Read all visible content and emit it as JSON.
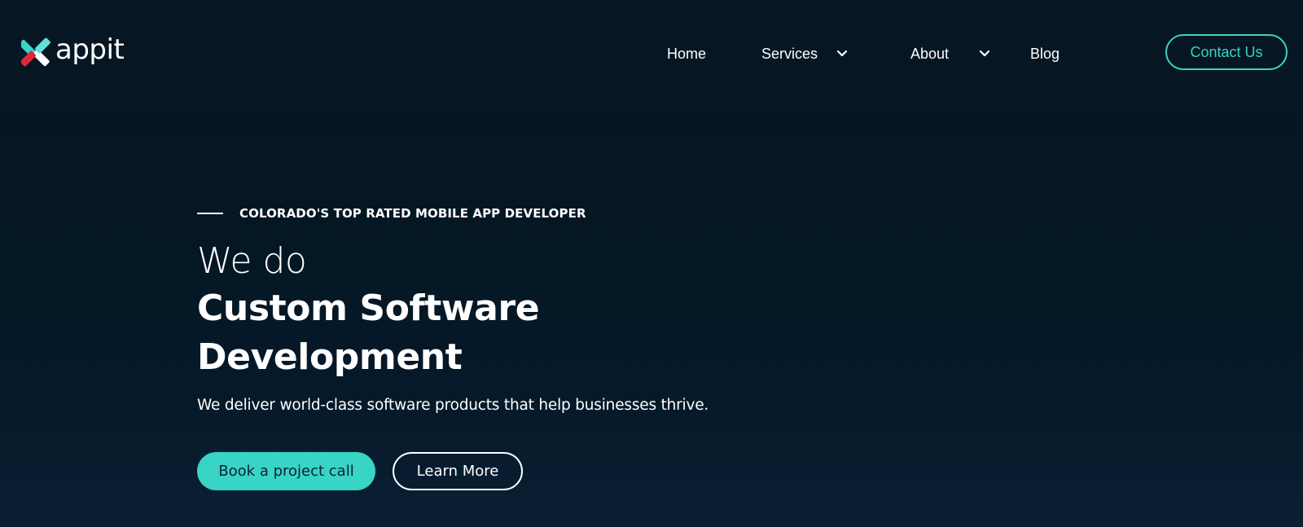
{
  "brand": {
    "name": "appit",
    "accent_color": "#38d4c6",
    "mark_colors": [
      "#38d4c6",
      "#e0283c",
      "#ffffff"
    ]
  },
  "nav": {
    "items": [
      {
        "label": "Home",
        "has_dropdown": false
      },
      {
        "label": "Services",
        "has_dropdown": true
      },
      {
        "label": "About",
        "has_dropdown": true
      },
      {
        "label": "Blog",
        "has_dropdown": false
      }
    ],
    "contact_label": "Contact Us"
  },
  "hero": {
    "eyebrow": "COLORADO'S TOP RATED MOBILE APP DEVELOPER",
    "headline_light": "We do",
    "headline_bold": "Custom Software Development",
    "subtitle": "We deliver world-class software products that help businesses thrive.",
    "primary_cta": "Book a project call",
    "secondary_cta": "Learn More"
  },
  "icons": {
    "logo": "appit-x-logo-icon",
    "dropdown": "chevron-down-icon"
  },
  "colors": {
    "background": "#041722",
    "text": "#ffffff"
  }
}
